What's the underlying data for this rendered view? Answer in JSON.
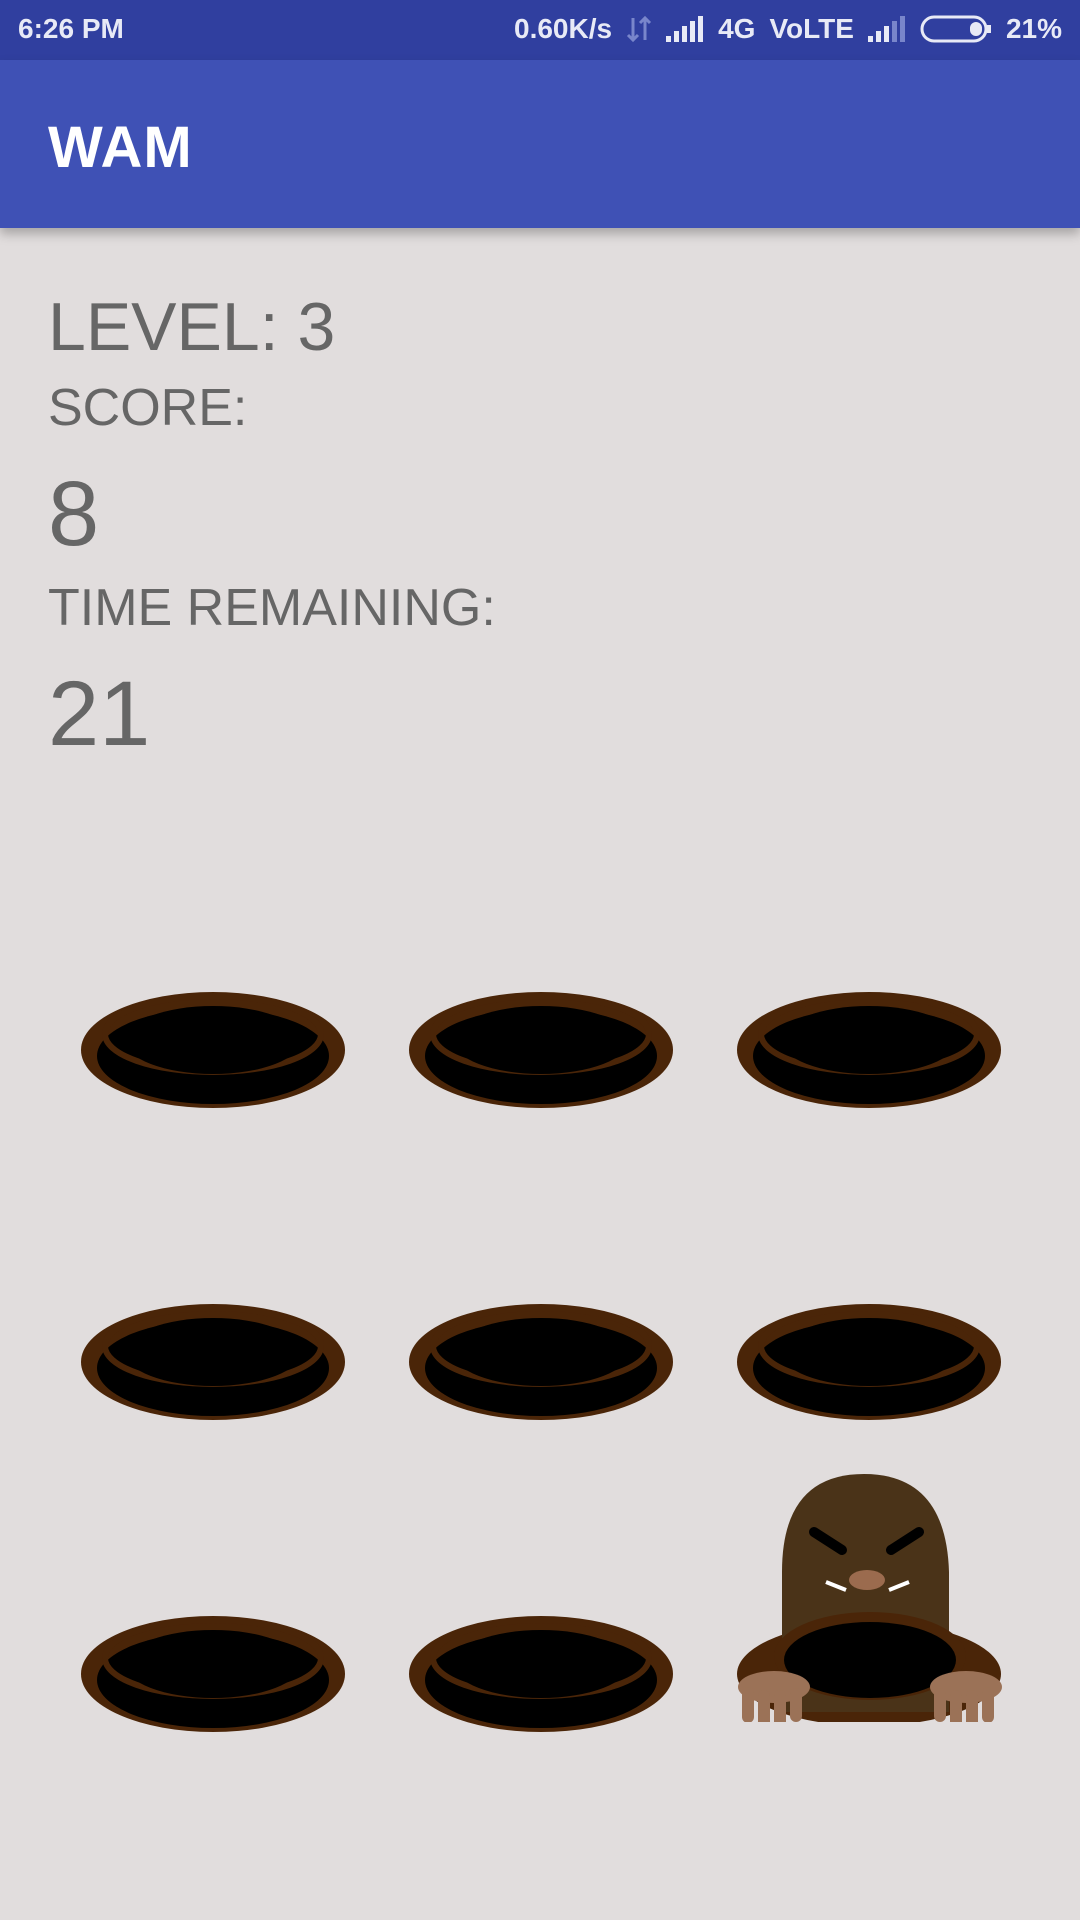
{
  "status_bar": {
    "time": "6:26 PM",
    "net_speed": "0.60K/s",
    "network": "4G",
    "volte": "VoLTE",
    "battery": "21%",
    "icons": [
      "data-transfer-icon",
      "signal-icon",
      "signal-icon-2",
      "battery-icon"
    ]
  },
  "app_bar": {
    "title": "WAM"
  },
  "game": {
    "level_text": "LEVEL: 3",
    "score_label": "SCORE:",
    "score_value": "8",
    "time_label": "TIME REMAINING:",
    "time_value": "21",
    "grid": {
      "rows": 3,
      "cols": 3,
      "mole_position": {
        "row": 3,
        "col": 3
      }
    },
    "colors": {
      "hole_rim": "#4a2508",
      "hole_inner": "#000000",
      "mole_body": "#4a3318",
      "mole_paw": "#9b7257"
    }
  }
}
